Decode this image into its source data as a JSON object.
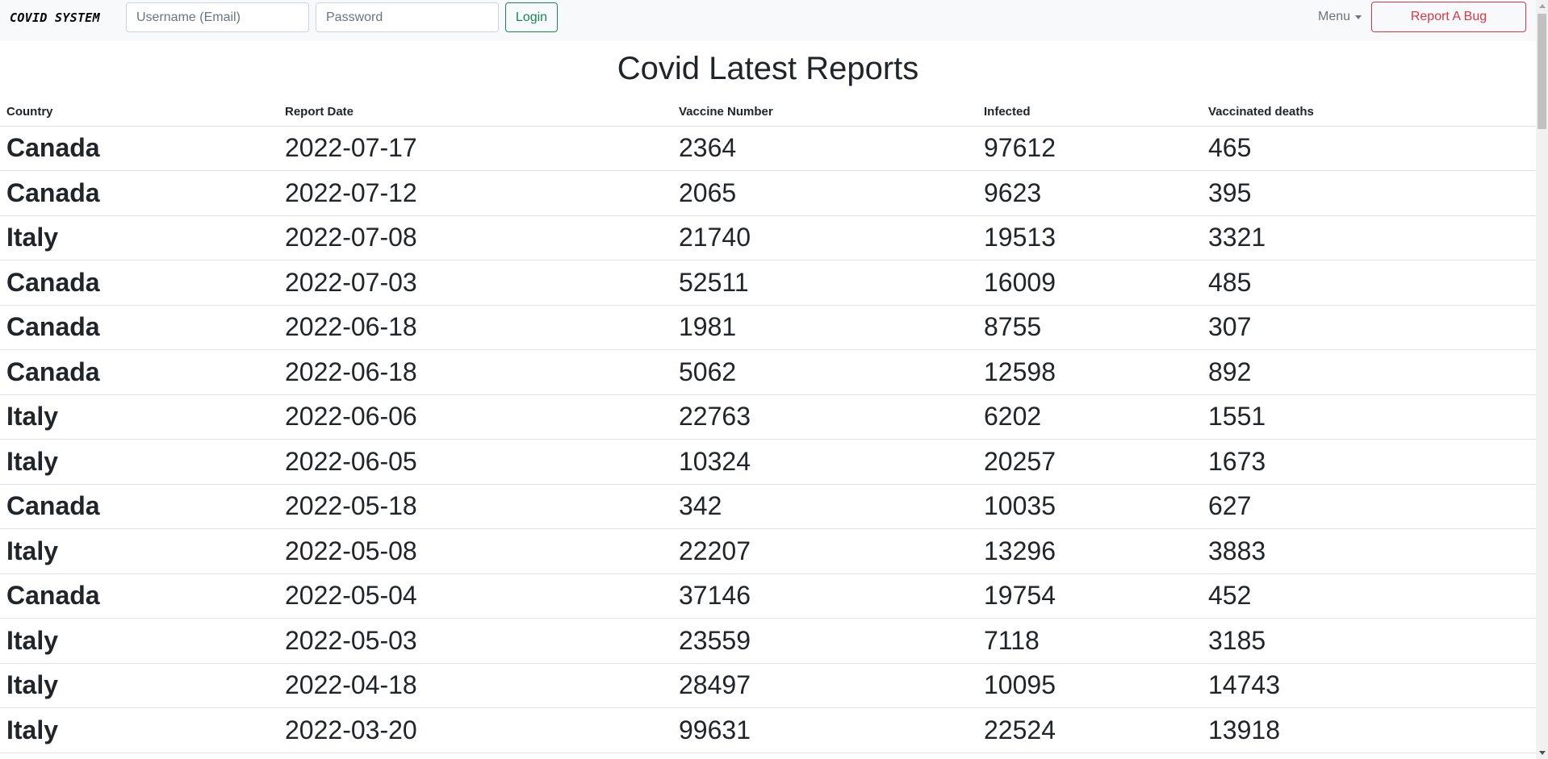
{
  "navbar": {
    "brand": "COVID SYSTEM",
    "username_placeholder": "Username (Email)",
    "password_placeholder": "Password",
    "login_label": "Login",
    "menu_label": "Menu",
    "report_bug_label": "Report A Bug",
    "colors": {
      "login": "#198754",
      "report_bug": "#dc3545",
      "navbar_bg": "#f8f9fa"
    }
  },
  "page_title": "Covid Latest Reports",
  "table": {
    "columns": [
      "Country",
      "Report Date",
      "Vaccine Number",
      "Infected",
      "Vaccinated deaths"
    ],
    "rows": [
      [
        "Canada",
        "2022-07-17",
        "2364",
        "97612",
        "465"
      ],
      [
        "Canada",
        "2022-07-12",
        "2065",
        "9623",
        "395"
      ],
      [
        "Italy",
        "2022-07-08",
        "21740",
        "19513",
        "3321"
      ],
      [
        "Canada",
        "2022-07-03",
        "52511",
        "16009",
        "485"
      ],
      [
        "Canada",
        "2022-06-18",
        "1981",
        "8755",
        "307"
      ],
      [
        "Canada",
        "2022-06-18",
        "5062",
        "12598",
        "892"
      ],
      [
        "Italy",
        "2022-06-06",
        "22763",
        "6202",
        "1551"
      ],
      [
        "Italy",
        "2022-06-05",
        "10324",
        "20257",
        "1673"
      ],
      [
        "Canada",
        "2022-05-18",
        "342",
        "10035",
        "627"
      ],
      [
        "Italy",
        "2022-05-08",
        "22207",
        "13296",
        "3883"
      ],
      [
        "Canada",
        "2022-05-04",
        "37146",
        "19754",
        "452"
      ],
      [
        "Italy",
        "2022-05-03",
        "23559",
        "7118",
        "3185"
      ],
      [
        "Italy",
        "2022-04-18",
        "28497",
        "10095",
        "14743"
      ],
      [
        "Italy",
        "2022-03-20",
        "99631",
        "22524",
        "13918"
      ]
    ]
  },
  "icons": {
    "menu_caret": "chevron-down-icon",
    "scroll_up": "scroll-up-arrow-icon",
    "scroll_down": "scroll-down-arrow-icon"
  }
}
